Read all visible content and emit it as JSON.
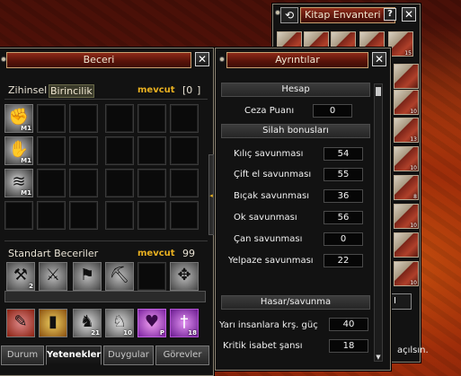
{
  "kitap": {
    "title": "Kitap Envanteri",
    "help": "?",
    "close": "✕",
    "right_col_counts": [
      "15",
      "",
      "10",
      "13",
      "10",
      "8",
      "10",
      "",
      "10"
    ],
    "tail_text": "açılsın.",
    "tail_box": "I"
  },
  "beceri": {
    "title": "Beceri",
    "close": "✕",
    "tab_mental": "Zihinsel",
    "tab_primary": "Birincilik",
    "mevcut": "mevcut",
    "points": "[0",
    "points_close": "]",
    "skills": [
      {
        "label": "M1",
        "icon": "dragon-fist-icon"
      },
      {
        "label": "M1",
        "icon": "dragon-roar-icon"
      },
      {
        "label": "M1",
        "icon": "dragon-wind-icon"
      }
    ],
    "standard_label": "Standart Beceriler",
    "standard_mevcut": "mevcut",
    "standard_points": "99",
    "standard_skills": [
      {
        "label": "2",
        "icon": "mining-icon"
      },
      {
        "label": "",
        "icon": "fishing-icon"
      },
      {
        "label": "",
        "icon": "flag-icon"
      },
      {
        "label": "",
        "icon": "pickaxe-icon"
      },
      {
        "label": "",
        "icon": "empty-slot"
      },
      {
        "label": "",
        "icon": "knot-icon"
      }
    ],
    "bottom_skills": [
      {
        "label": "",
        "icon": "horse-riding-icon"
      },
      {
        "label": "",
        "icon": "scroll-icon"
      },
      {
        "label": "21",
        "icon": "horse-icon"
      },
      {
        "label": "10",
        "icon": "horse-armor-icon"
      },
      {
        "label": "P",
        "icon": "heart-icon"
      },
      {
        "label": "18",
        "icon": "sword-icon"
      }
    ],
    "tabs": [
      "Durum",
      "Yetenekler",
      "Duygular",
      "Görevler"
    ]
  },
  "ayrintilar": {
    "title": "Ayrıntılar",
    "close": "✕",
    "hesap": "Hesap",
    "ceza_label": "Ceza Puanı",
    "ceza_value": "0",
    "silah_header": "Silah bonusları",
    "silah": [
      {
        "label": "Kılıç savunması",
        "value": "54"
      },
      {
        "label": "Çift el savunması",
        "value": "55"
      },
      {
        "label": "Bıçak savunması",
        "value": "36"
      },
      {
        "label": "Ok savunması",
        "value": "56"
      },
      {
        "label": "Çan savunması",
        "value": "0"
      },
      {
        "label": "Yelpaze savunması",
        "value": "22"
      }
    ],
    "hasar_header": "Hasar/savunma",
    "hasar": [
      {
        "label": "Yarı insanlara krş. güç",
        "value": "40"
      },
      {
        "label": "Kritik isabet şansı",
        "value": "18"
      }
    ]
  }
}
